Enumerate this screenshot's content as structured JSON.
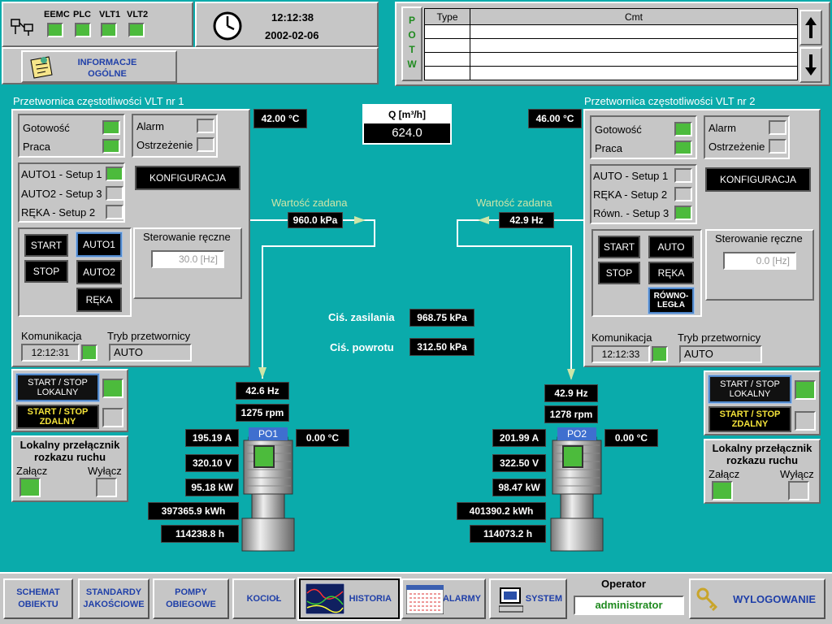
{
  "header": {
    "sys_labels": [
      "EEMC",
      "PLC",
      "VLT1",
      "VLT2"
    ],
    "time": "12:12:38",
    "date": "2002-02-06",
    "info_button": "INFORMACJE OGÓLNE",
    "potw_label": "POTW",
    "msg_headers": [
      "Type",
      "Cmt"
    ]
  },
  "flow": {
    "label": "Q [m³/h]",
    "value": "624.0"
  },
  "vlt1": {
    "title": "Przetwornica częstotliwości VLT nr 1",
    "temp": "42.00 °C",
    "gotowosc": "Gotowość",
    "praca": "Praca",
    "alarm": "Alarm",
    "ostrzezenie": "Ostrzeżenie",
    "setups": [
      "AUTO1 - Setup 1",
      "AUTO2 - Setup 3",
      "RĘKA - Setup 2"
    ],
    "config": "KONFIGURACJA",
    "start": "START",
    "stop": "STOP",
    "auto1": "AUTO1",
    "auto2": "AUTO2",
    "reka": "RĘKA",
    "manual_label": "Sterowanie ręczne",
    "manual_value": "30.0 [Hz]",
    "comm_label": "Komunikacja",
    "comm_time": "12:12:31",
    "mode_label": "Tryb przetwornicy",
    "mode_value": "AUTO",
    "setpoint_label": "Wartość zadana",
    "setpoint": "960.0 kPa"
  },
  "vlt2": {
    "title": "Przetwornica częstotliwości VLT nr 2",
    "temp": "46.00 °C",
    "gotowosc": "Gotowość",
    "praca": "Praca",
    "alarm": "Alarm",
    "ostrzezenie": "Ostrzeżenie",
    "setups": [
      "AUTO - Setup 1",
      "RĘKA - Setup 2",
      "Równ. - Setup 3"
    ],
    "config": "KONFIGURACJA",
    "start": "START",
    "stop": "STOP",
    "auto": "AUTO",
    "reka": "RĘKA",
    "rownolegla": "RÓWNO-LEGŁA",
    "manual_label": "Sterowanie ręczne",
    "manual_value": "0.0 [Hz]",
    "comm_label": "Komunikacja",
    "comm_time": "12:12:33",
    "mode_label": "Tryb przetwornicy",
    "mode_value": "AUTO",
    "setpoint_label": "Wartość zadana",
    "setpoint": "42.9 Hz"
  },
  "local1": {
    "start_stop_local": "START / STOP LOKALNY",
    "start_stop_remote": "START / STOP ZDALNY",
    "switch_title": "Lokalny przełącznik rozkazu ruchu",
    "on": "Załącz",
    "off": "Wyłącz"
  },
  "local2": {
    "start_stop_local": "START / STOP LOKALNY",
    "start_stop_remote": "START / STOP ZDALNY",
    "switch_title": "Lokalny przełącznik rozkazu ruchu",
    "on": "Załącz",
    "off": "Wyłącz"
  },
  "pressure": {
    "supply_label": "Ciś. zasilania",
    "supply_value": "968.75 kPa",
    "return_label": "Ciś. powrotu",
    "return_value": "312.50 kPa"
  },
  "pump1": {
    "name": "PO1",
    "freq": "42.6 Hz",
    "rpm": "1275 rpm",
    "current": "195.19 A",
    "voltage": "320.10 V",
    "power": "95.18 kW",
    "energy": "397365.9 kWh",
    "hours": "114238.8 h",
    "temp": "0.00 °C"
  },
  "pump2": {
    "name": "PO2",
    "freq": "42.9 Hz",
    "rpm": "1278 rpm",
    "current": "201.99 A",
    "voltage": "322.50 V",
    "power": "98.47 kW",
    "energy": "401390.2 kWh",
    "hours": "114073.2 h",
    "temp": "0.00 °C"
  },
  "nav": {
    "schemat": "SCHEMAT OBIEKTU",
    "standardy": "STANDARDY JAKOŚCIOWE",
    "pompy": "POMPY OBIEGOWE",
    "kociol": "KOCIOŁ",
    "historia": "HISTORIA",
    "alarmy": "ALARMY",
    "system": "SYSTEM",
    "operator_label": "Operator",
    "operator_value": "administrator",
    "logout": "WYLOGOWANIE"
  },
  "colors": {
    "background": "#0aabab",
    "panel": "#c6c6c6",
    "led_on": "#4cbb3c",
    "nav_text": "#1f3fa8"
  }
}
